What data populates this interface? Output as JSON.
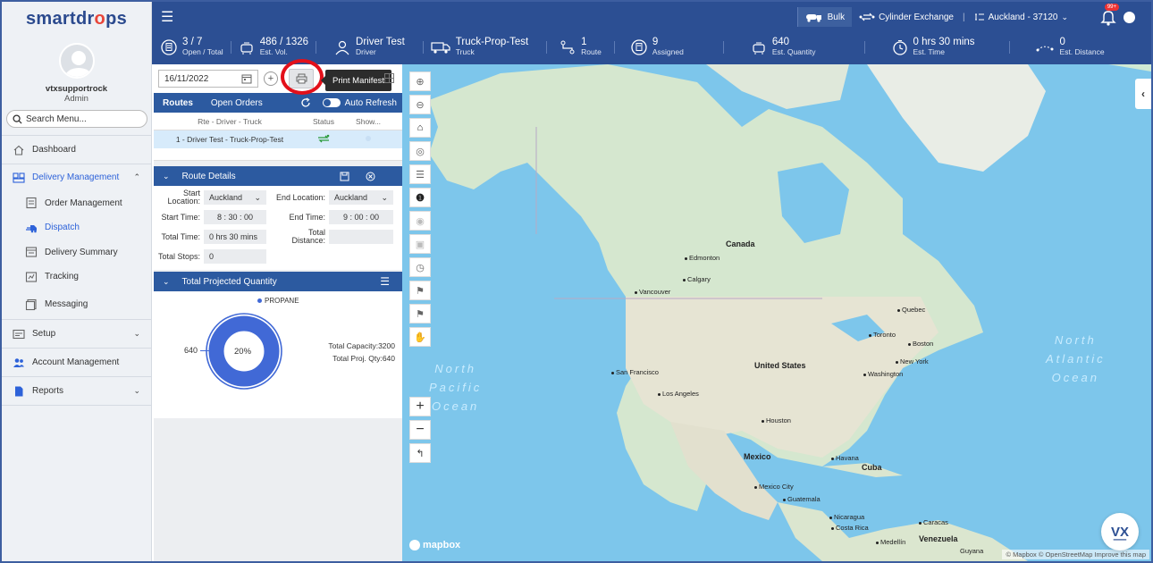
{
  "sidebar": {
    "logo_pre": "smartdr",
    "logo_o": "o",
    "logo_post": "ps",
    "user_name": "vtxsupportrock",
    "user_role": "Admin",
    "search_placeholder": "Search Menu...",
    "items": [
      {
        "label": "Dashboard"
      },
      {
        "label": "Delivery Management"
      },
      {
        "label": "Order Management"
      },
      {
        "label": "Dispatch"
      },
      {
        "label": "Delivery Summary"
      },
      {
        "label": "Tracking"
      },
      {
        "label": "Messaging"
      },
      {
        "label": "Setup"
      },
      {
        "label": "Account Management"
      },
      {
        "label": "Reports"
      }
    ]
  },
  "topbar": {
    "bulk_label": "Bulk",
    "cylinder_label": "Cylinder Exchange",
    "location_label": "Auckland - 37120",
    "notification_count": "99+",
    "stats": [
      {
        "value": "3 / 7",
        "label": "Open / Total"
      },
      {
        "value": "486 / 1326",
        "label": "Est. Vol."
      },
      {
        "value": "Driver Test",
        "label": "Driver"
      },
      {
        "value": "Truck-Prop-Test",
        "label": "Truck"
      },
      {
        "value": "1",
        "label": "Route"
      },
      {
        "value": "9",
        "label": "Assigned"
      },
      {
        "value": "640",
        "label": "Est. Quantity"
      },
      {
        "value": "0 hrs 30 mins",
        "label": "Est. Time"
      },
      {
        "value": "0",
        "label": "Est. Distance"
      }
    ]
  },
  "panel": {
    "date_value": "16/11/2022",
    "print_tooltip": "Print Manifest",
    "tabs": [
      "Routes",
      "Open Orders"
    ],
    "auto_refresh_label": "Auto Refresh",
    "columns": [
      "Rte - Driver - Truck",
      "Status",
      "Show..."
    ],
    "route_row": "1 - Driver Test - Truck-Prop-Test",
    "route_details_title": "Route Details",
    "start_location_label": "Start Location:",
    "start_location_value": "Auckland",
    "end_location_label": "End Location:",
    "end_location_value": "Auckland",
    "start_time_label": "Start Time:",
    "start_time_value": "8 : 30 : 00",
    "end_time_label": "End Time:",
    "end_time_value": "9 : 00 : 00",
    "total_time_label": "Total Time:",
    "total_time_value": "0 hrs 30 mins",
    "total_distance_label": "Total Distance:",
    "total_distance_value": "",
    "total_stops_label": "Total Stops:",
    "total_stops_value": "0",
    "tpq_title": "Total Projected Quantity",
    "legend_item": "PROPANE",
    "donut_value": "640",
    "donut_percent": "20%",
    "donut_fraction": 0.2,
    "total_capacity": "Total Capacity:3200",
    "total_proj_qty": "Total Proj. Qty:640"
  },
  "map": {
    "cities": [
      "Canada",
      "Edmonton",
      "Calgary",
      "Vancouver",
      "Quebec",
      "Toronto",
      "Boston",
      "New York",
      "Washington",
      "United States",
      "San Francisco",
      "Los Angeles",
      "Houston",
      "Mexico",
      "Mexico City",
      "Havana",
      "Cuba",
      "Guatemala",
      "Nicaragua",
      "Costa Rica",
      "Caracas",
      "Medellín",
      "Venezuela",
      "Guyana"
    ],
    "ocean_pacific": [
      "North",
      "Pacific",
      "Ocean"
    ],
    "ocean_atlantic": [
      "North",
      "Atlantic",
      "Ocean"
    ],
    "mapbox_label": "mapbox",
    "attribution": "© Mapbox © OpenStreetMap Improve this map",
    "vx_logo": "V͟X"
  },
  "colors": {
    "primary": "#2c4f93",
    "accent": "#2c5aa0",
    "donut": "#4169d6",
    "highlight": "#e3101a"
  }
}
